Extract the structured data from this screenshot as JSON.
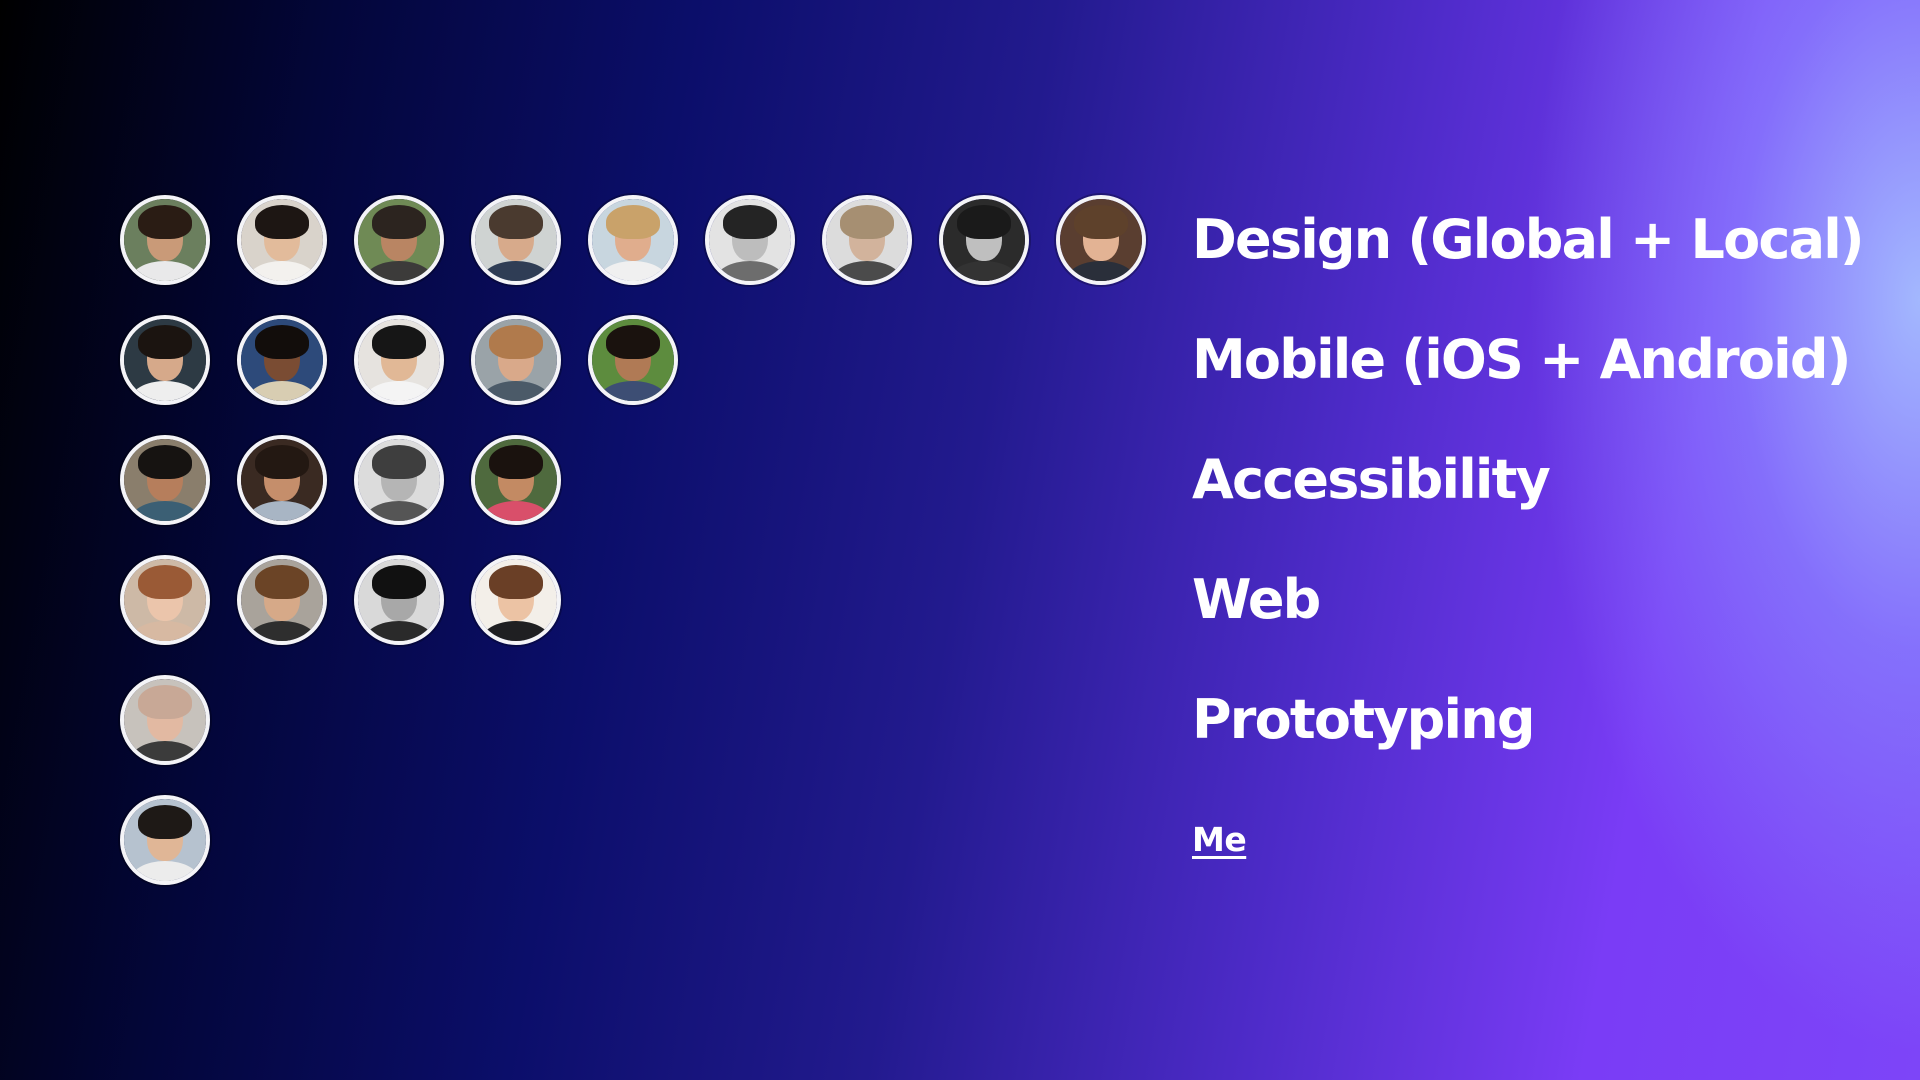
{
  "slide": {
    "rows": [
      {
        "label": "Design (Global + Local)",
        "avatars": [
          {
            "bg": "#6b7f5e",
            "hair": "#2a1c14",
            "skin": "#c99a78",
            "shirt": "#e9e9ea"
          },
          {
            "bg": "#d9d3cb",
            "hair": "#1d1613",
            "skin": "#e2bb9b",
            "shirt": "#f3f1ee"
          },
          {
            "bg": "#6f8a55",
            "hair": "#2c241f",
            "skin": "#b98563",
            "shirt": "#3c3b3a"
          },
          {
            "bg": "#cfd3d2",
            "hair": "#4a3a2f",
            "skin": "#d7aa8b",
            "shirt": "#2f3d55"
          },
          {
            "bg": "#c8d6df",
            "hair": "#c9a26a",
            "skin": "#e0ad8d",
            "shirt": "#f0f0f0"
          },
          {
            "bg": "#e3e3e3",
            "hair": "#242424",
            "skin": "#bdbdbd",
            "shirt": "#6d6d6d"
          },
          {
            "bg": "#dcdcdc",
            "hair": "#a68f72",
            "skin": "#d2b39c",
            "shirt": "#4b4b4b"
          },
          {
            "bg": "#2b2b2b",
            "hair": "#1a1a1a",
            "skin": "#bfbfbf",
            "shirt": "#333333"
          },
          {
            "bg": "#5a3e30",
            "hair": "#5e412b",
            "skin": "#e3b394",
            "shirt": "#2a2f3a"
          }
        ]
      },
      {
        "label": "Mobile (iOS + Android)",
        "avatars": [
          {
            "bg": "#2d3a44",
            "hair": "#1b1410",
            "skin": "#d6a98a",
            "shirt": "#eeeeee"
          },
          {
            "bg": "#2d4a7a",
            "hair": "#120d0b",
            "skin": "#7a4c33",
            "shirt": "#d8cdb2"
          },
          {
            "bg": "#e6e3df",
            "hair": "#161616",
            "skin": "#e1b896",
            "shirt": "#f4f4f4"
          },
          {
            "bg": "#9aa3a8",
            "hair": "#b07a4c",
            "skin": "#d9a98a",
            "shirt": "#4b5a68"
          },
          {
            "bg": "#5d8c3e",
            "hair": "#1a120e",
            "skin": "#b07a55",
            "shirt": "#3d4e74"
          }
        ]
      },
      {
        "label": "Accessibility",
        "avatars": [
          {
            "bg": "#8a7e6c",
            "hair": "#161311",
            "skin": "#b67e5c",
            "shirt": "#3b5f74"
          },
          {
            "bg": "#3a2a22",
            "hair": "#231812",
            "skin": "#c58e6b",
            "shirt": "#a8b5c4"
          },
          {
            "bg": "#dcdcdc",
            "hair": "#3e3e3e",
            "skin": "#b5b5b5",
            "shirt": "#555555"
          },
          {
            "bg": "#4f6a3e",
            "hair": "#1a120e",
            "skin": "#c38a63",
            "shirt": "#d94f6a"
          }
        ]
      },
      {
        "label": "Web",
        "avatars": [
          {
            "bg": "#cdb9a6",
            "hair": "#9a5a36",
            "skin": "#ebc5ab",
            "shirt": "#d7b9a2"
          },
          {
            "bg": "#a9a39b",
            "hair": "#6b4426",
            "skin": "#d6a988",
            "shirt": "#2e2e2e"
          },
          {
            "bg": "#d9d9d9",
            "hair": "#111111",
            "skin": "#a8a8a8",
            "shirt": "#2a2a2a"
          },
          {
            "bg": "#f3efe9",
            "hair": "#6a3f26",
            "skin": "#ecc3a4",
            "shirt": "#1f1f22"
          }
        ]
      },
      {
        "label": "Prototyping",
        "avatars": [
          {
            "bg": "#c7c2bc",
            "hair": "#c8a896",
            "skin": "#e2b9a2",
            "shirt": "#3b3b3b"
          }
        ]
      },
      {
        "label": "Me",
        "is_link": true,
        "avatars": [
          {
            "bg": "#b6c2cf",
            "hair": "#1e1916",
            "skin": "#e0b696",
            "shirt": "#ececec"
          }
        ]
      }
    ]
  }
}
